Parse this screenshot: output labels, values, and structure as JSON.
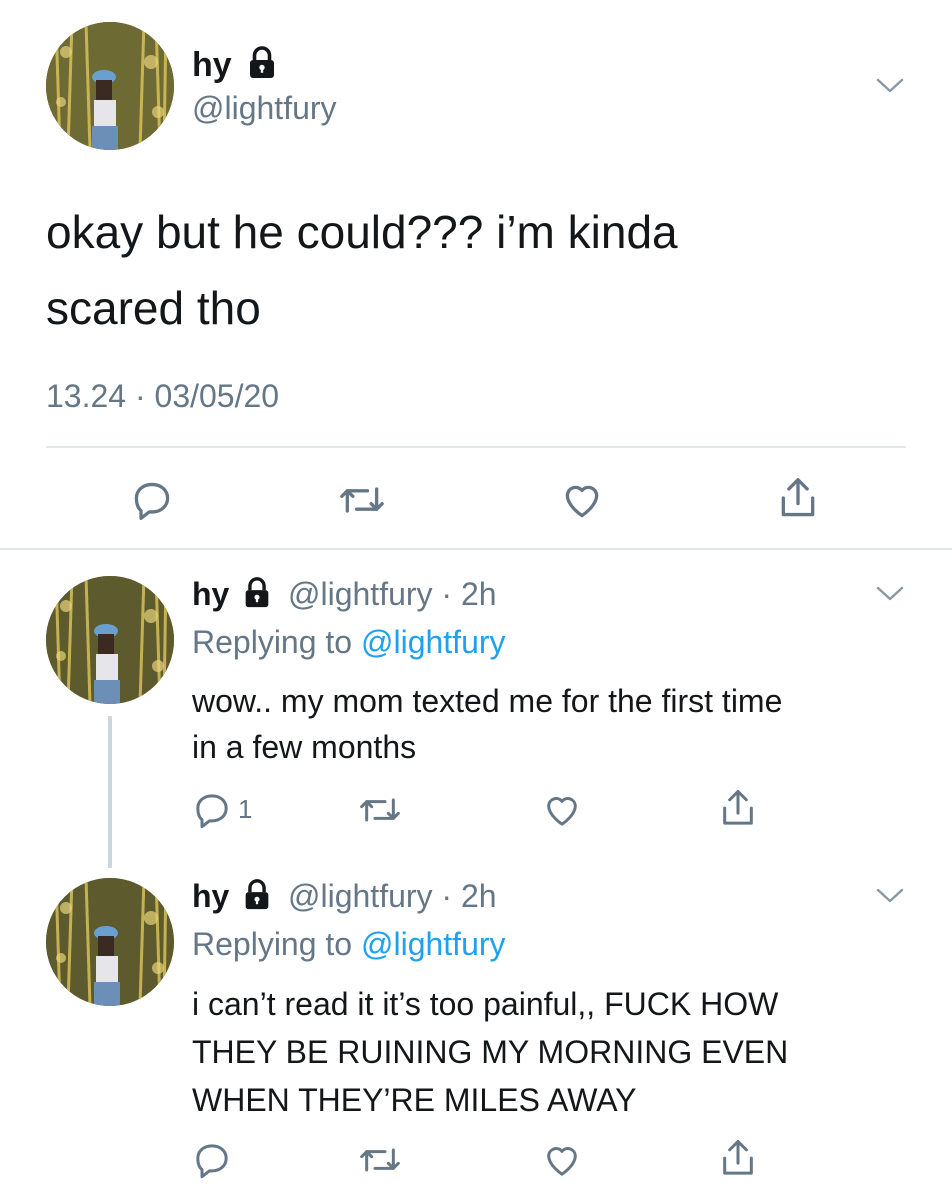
{
  "main_tweet": {
    "display_name": "hy",
    "handle": "@lightfury",
    "text_line1": "okay but he could??? i’m kinda",
    "text_line2": "scared tho",
    "timestamp": "13.24 · 03/05/20"
  },
  "replies": [
    {
      "display_name": "hy",
      "handle_time": "@lightfury · 2h",
      "replying_prefix": "Replying to",
      "replying_handle": "@lightfury",
      "text_line1": "wow.. my mom texted me for the first time",
      "text_line2": "in a few months",
      "reply_count": "1"
    },
    {
      "display_name": "hy",
      "handle_time": "@lightfury · 2h",
      "replying_prefix": "Replying to",
      "replying_handle": "@lightfury",
      "text_line1": "i can’t read it it’s too painful,, FUCK HOW",
      "text_line2": "THEY BE RUINING MY MORNING EVEN",
      "text_line3": "WHEN THEY’RE MILES AWAY",
      "reply_count": ""
    }
  ],
  "icons": {
    "lock": "lock-icon",
    "chevron": "chevron-down-icon",
    "reply": "reply-icon",
    "retweet": "retweet-icon",
    "like": "like-icon",
    "share": "share-icon"
  },
  "colors": {
    "text": "#14171a",
    "secondary": "#657786",
    "link": "#1da1f2",
    "divider": "#e1e8ed"
  }
}
